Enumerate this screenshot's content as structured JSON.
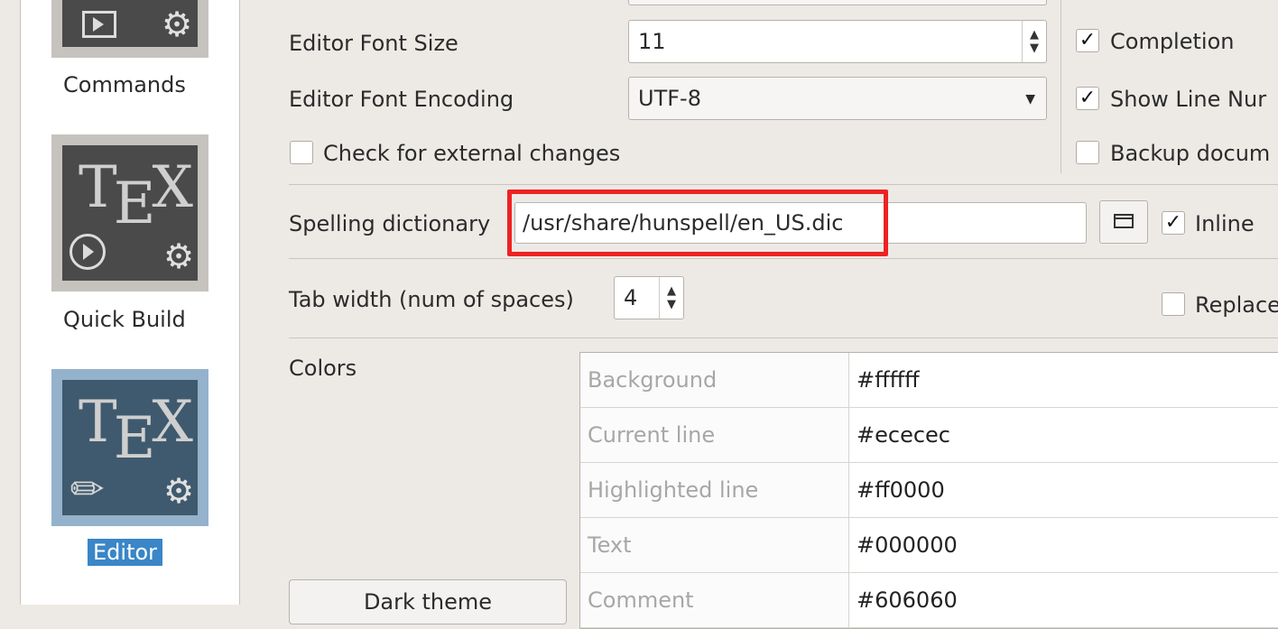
{
  "sidebar": {
    "items": [
      {
        "label": "Commands"
      },
      {
        "label": "Quick Build"
      },
      {
        "label": "Editor"
      }
    ],
    "tex_logo": "TEX"
  },
  "editor": {
    "font_size_label": "Editor Font Size",
    "font_size_value": "11",
    "encoding_label": "Editor Font Encoding",
    "encoding_value": "UTF-8",
    "check_external_label": "Check for external changes",
    "completion_label": "Completion",
    "show_line_numbers_label": "Show Line Nur",
    "backup_label": "Backup docum",
    "spelling_label": "Spelling dictionary",
    "spelling_value": "/usr/share/hunspell/en_US.dic",
    "inline_label": "Inline",
    "tab_width_label": "Tab width (num of spaces)",
    "tab_width_value": "4",
    "replace_label": "Replace",
    "colors_label": "Colors",
    "dark_theme_button": "Dark theme"
  },
  "colors": [
    {
      "name": "Background",
      "value": "#ffffff"
    },
    {
      "name": "Current line",
      "value": "#ececec"
    },
    {
      "name": "Highlighted line",
      "value": "#ff0000"
    },
    {
      "name": "Text",
      "value": "#000000"
    },
    {
      "name": "Comment",
      "value": "#606060"
    }
  ],
  "icons": {
    "gear": "gear-icon",
    "play": "play-icon",
    "pencil": "pencil-icon",
    "folder": "folder-icon"
  }
}
